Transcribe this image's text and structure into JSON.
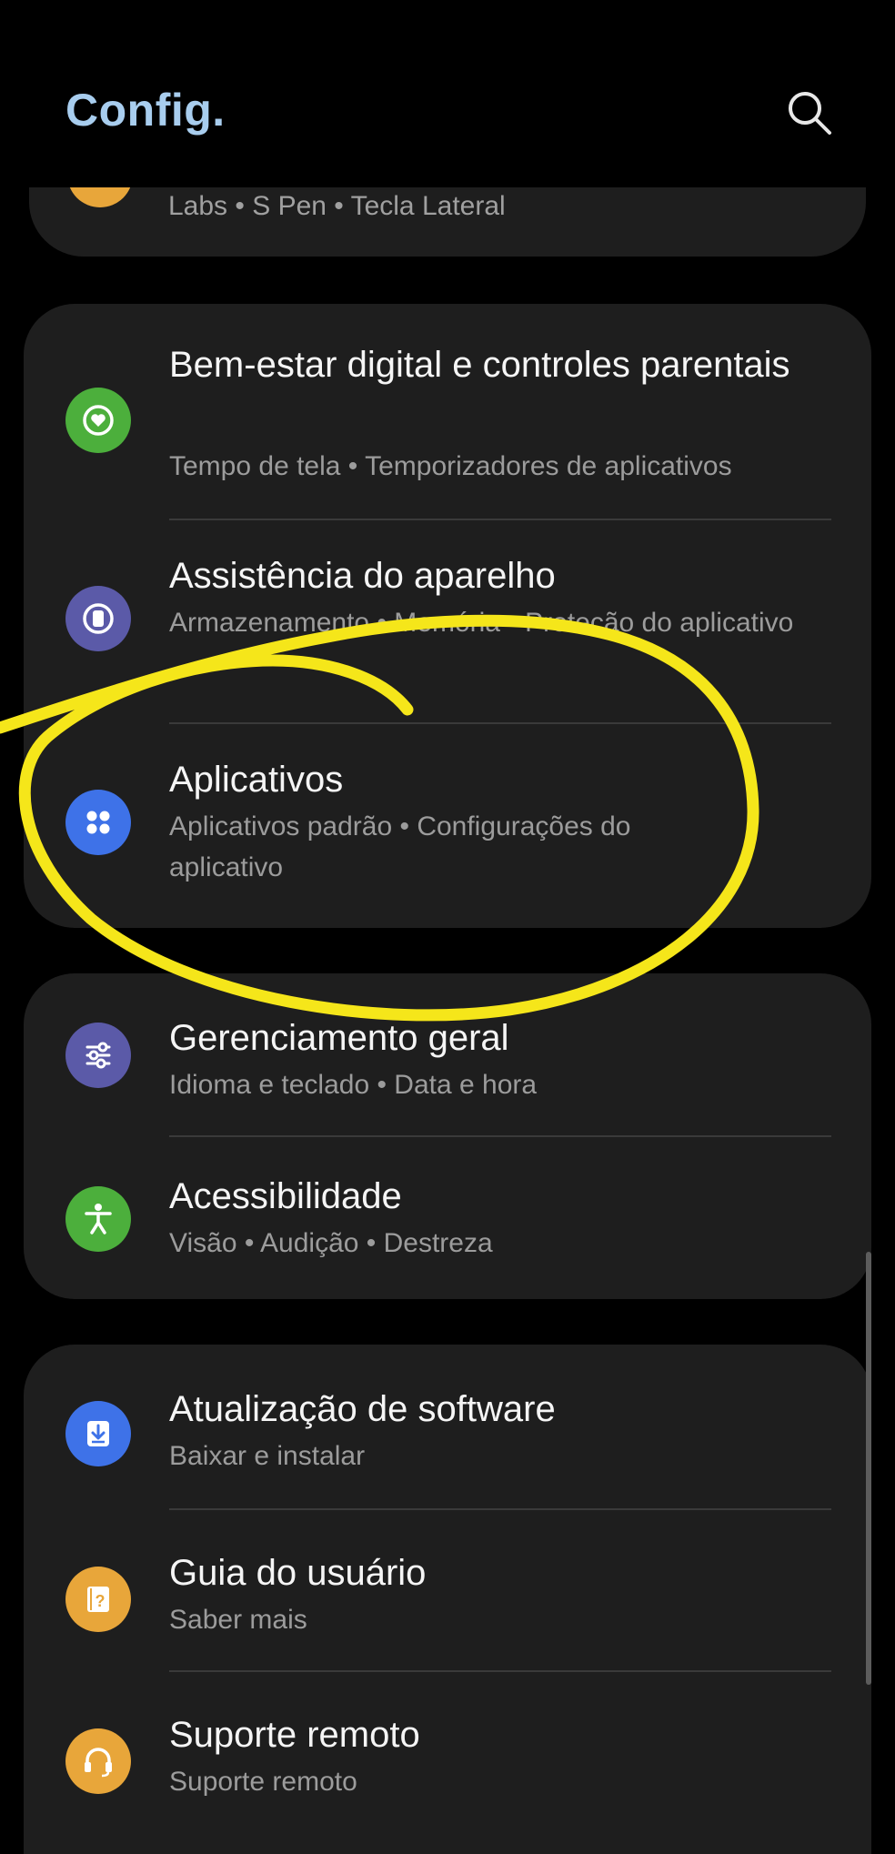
{
  "header": {
    "title": "Config.",
    "search_icon": "search-icon",
    "title_color": "#a8cdee"
  },
  "top_item": {
    "subtitle": "Labs  •  S Pen  •  Tecla Lateral",
    "icon": "advanced-features-icon",
    "icon_color": "#e8a63a"
  },
  "group_a": [
    {
      "title": "Bem-estar digital e controles parentais",
      "subtitle": "Tempo de tela  •  Temporizadores de aplicativos",
      "icon": "digital-wellbeing-icon",
      "icon_color": "#4caf3c"
    },
    {
      "title": "Assistência do aparelho",
      "subtitle": "Armazenamento  •  Memória  •  Proteção do aplicativo",
      "icon": "device-care-icon",
      "icon_color": "#5b5aa8"
    },
    {
      "title": "Aplicativos",
      "subtitle": "Aplicativos padrão  •  Configurações do aplicativo",
      "icon": "apps-icon",
      "icon_color": "#3e72e8"
    }
  ],
  "group_b": [
    {
      "title": "Gerenciamento geral",
      "subtitle": "Idioma e teclado  •  Data e hora",
      "icon": "general-management-icon",
      "icon_color": "#5b5aa8"
    },
    {
      "title": "Acessibilidade",
      "subtitle": "Visão  •  Audição  •  Destreza",
      "icon": "accessibility-icon",
      "icon_color": "#4caf3c"
    }
  ],
  "group_c": [
    {
      "title": "Atualização de software",
      "subtitle": "Baixar e instalar",
      "icon": "software-update-icon",
      "icon_color": "#3e72e8"
    },
    {
      "title": "Guia do usuário",
      "subtitle": "Saber mais",
      "icon": "user-manual-icon",
      "icon_color": "#e8a63a"
    },
    {
      "title": "Suporte remoto",
      "subtitle": "Suporte remoto",
      "icon": "remote-support-icon",
      "icon_color": "#e8a63a"
    }
  ],
  "annotation": {
    "type": "yellow-freehand-circle",
    "color": "#f5e61a"
  }
}
